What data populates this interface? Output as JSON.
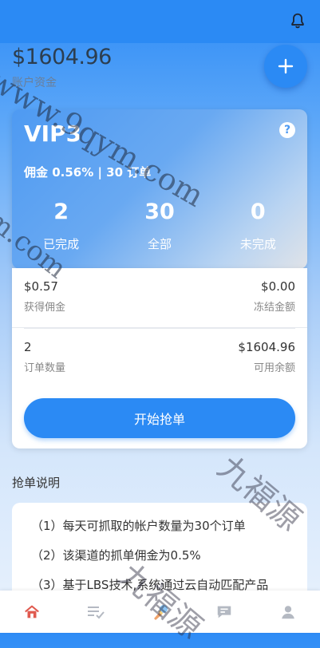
{
  "header": {
    "balance": "$1604.96",
    "balance_label": "账户资金"
  },
  "vip": {
    "level": "VIP3",
    "commission_line": "佣金 0.56% | 30 订单"
  },
  "stats": [
    {
      "value": "2",
      "label": "已完成"
    },
    {
      "value": "30",
      "label": "全部"
    },
    {
      "value": "0",
      "label": "未完成"
    }
  ],
  "summary": {
    "earned_commission_value": "$0.57",
    "earned_commission_label": "获得佣金",
    "frozen_value": "$0.00",
    "frozen_label": "冻结金额",
    "order_count_value": "2",
    "order_count_label": "订单数量",
    "available_value": "$1604.96",
    "available_label": "可用余额"
  },
  "actions": {
    "start_grab": "开始抢单"
  },
  "rules": {
    "title": "抢单说明",
    "items": [
      "（1）每天可抓取的帐户数量为30个订单",
      "（2）该渠道的抓单佣金为0.5%",
      "（3）基于LBS技术,系统通过云自动匹配产品"
    ]
  },
  "tabs": [
    "home-icon",
    "orders-icon",
    "grab-icon",
    "message-icon",
    "user-icon"
  ],
  "colors": {
    "primary": "#2b8af4",
    "tab_active": "#e05a4f",
    "tab_inactive": "#b4b9c2"
  },
  "watermarks": [
    "www.9qym.com",
    "m.com",
    "九福源",
    "九福源"
  ]
}
